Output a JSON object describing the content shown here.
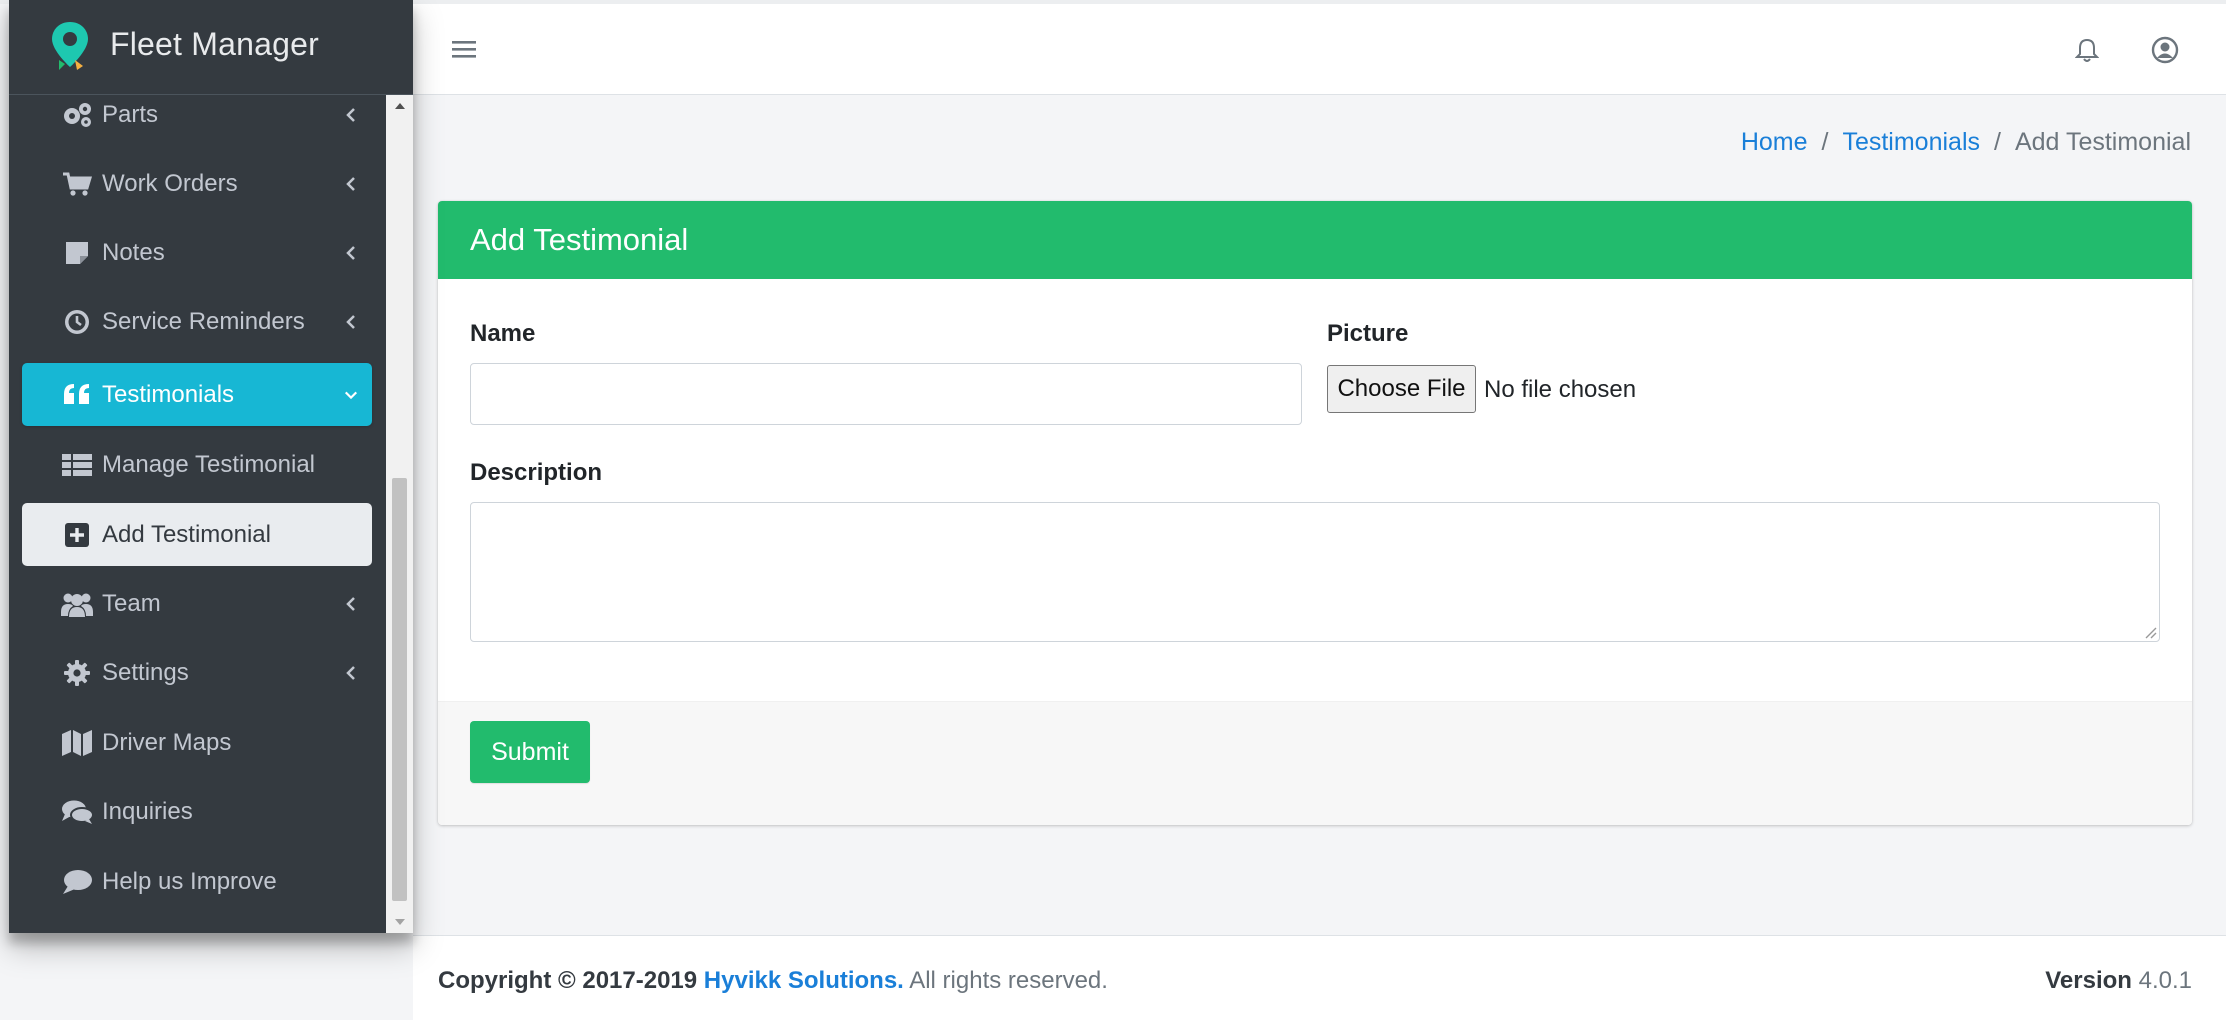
{
  "brand": {
    "name": "Fleet Manager",
    "logo_icon": "map-pin-logo"
  },
  "sidebar": {
    "items": [
      {
        "label": "Parts",
        "icon": "gears-icon",
        "chevron": "left"
      },
      {
        "label": "Work Orders",
        "icon": "cart-icon",
        "chevron": "left"
      },
      {
        "label": "Notes",
        "icon": "sticky-note-icon",
        "chevron": "left"
      },
      {
        "label": "Service Reminders",
        "icon": "clock-icon",
        "chevron": "left"
      },
      {
        "label": "Testimonials",
        "icon": "quote-icon",
        "chevron": "down",
        "state": "active"
      },
      {
        "label": "Manage Testimonial",
        "icon": "table-icon"
      },
      {
        "label": "Add Testimonial",
        "icon": "plus-square-icon",
        "state": "selected"
      },
      {
        "label": "Team",
        "icon": "users-icon",
        "chevron": "left"
      },
      {
        "label": "Settings",
        "icon": "gear-icon",
        "chevron": "left"
      },
      {
        "label": "Driver Maps",
        "icon": "map-icon"
      },
      {
        "label": "Inquiries",
        "icon": "comments-icon"
      },
      {
        "label": "Help us Improve",
        "icon": "comment-icon"
      }
    ]
  },
  "topbar": {
    "menu_icon": "hamburger-icon",
    "notifications_icon": "bell-icon",
    "user_icon": "user-circle-icon"
  },
  "breadcrumb": {
    "home": "Home",
    "section": "Testimonials",
    "current": "Add Testimonial",
    "separator": "/"
  },
  "form": {
    "title": "Add Testimonial",
    "name_label": "Name",
    "name_value": "",
    "picture_label": "Picture",
    "file_button": "Choose File",
    "file_status": "No file chosen",
    "description_label": "Description",
    "description_value": "",
    "submit_label": "Submit"
  },
  "footer": {
    "copyright_prefix": "Copyright © 2017-2019",
    "company": "Hyvikk Solutions.",
    "rights": "All rights reserved.",
    "version_label": "Version",
    "version_value": "4.0.1"
  },
  "colors": {
    "sidebar_bg": "#343a40",
    "active": "#17b7d4",
    "success": "#22bb6d",
    "link": "#1a7fd8"
  }
}
